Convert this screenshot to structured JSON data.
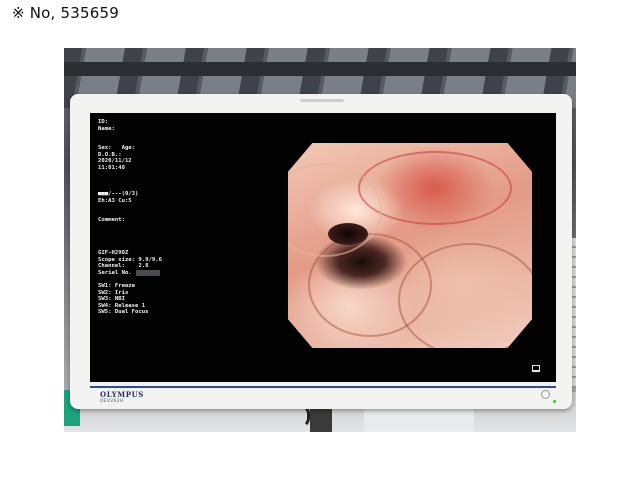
{
  "caption": "※ No, 535659",
  "osd": {
    "id_label": "ID:",
    "name_label": "Name:",
    "sex_age": "Sex:   Age:",
    "dob_label": "D.O.B.:",
    "date": "2020/11/12",
    "time": "11:01:48",
    "indicator": "■■■/---(0/3)",
    "enhancement": "Eh:A3 Cu:5",
    "comment_label": "Comment:",
    "scope_model": "GIF-H290Z",
    "scope_size": "Scope size: 9.9/9.6",
    "channel": "Channel:    2.8",
    "serial_label": "Serial No.",
    "sw1": "SW1: Freeze",
    "sw2": "SW2: Iris",
    "sw3": "SW3: NBI",
    "sw4": "SW4: Release 1",
    "sw5": "SW5: Dual Focus"
  },
  "monitor": {
    "brand": "OLYMPUS",
    "model": "OEV262H"
  },
  "colors": {
    "screen_bg": "#020203",
    "bezel": "#f3f3f1",
    "brand_blue": "#1e2f6b",
    "led_green": "#2ecc40"
  },
  "icons": [
    "screen-mode-icon",
    "power-icon",
    "power-led-icon"
  ]
}
